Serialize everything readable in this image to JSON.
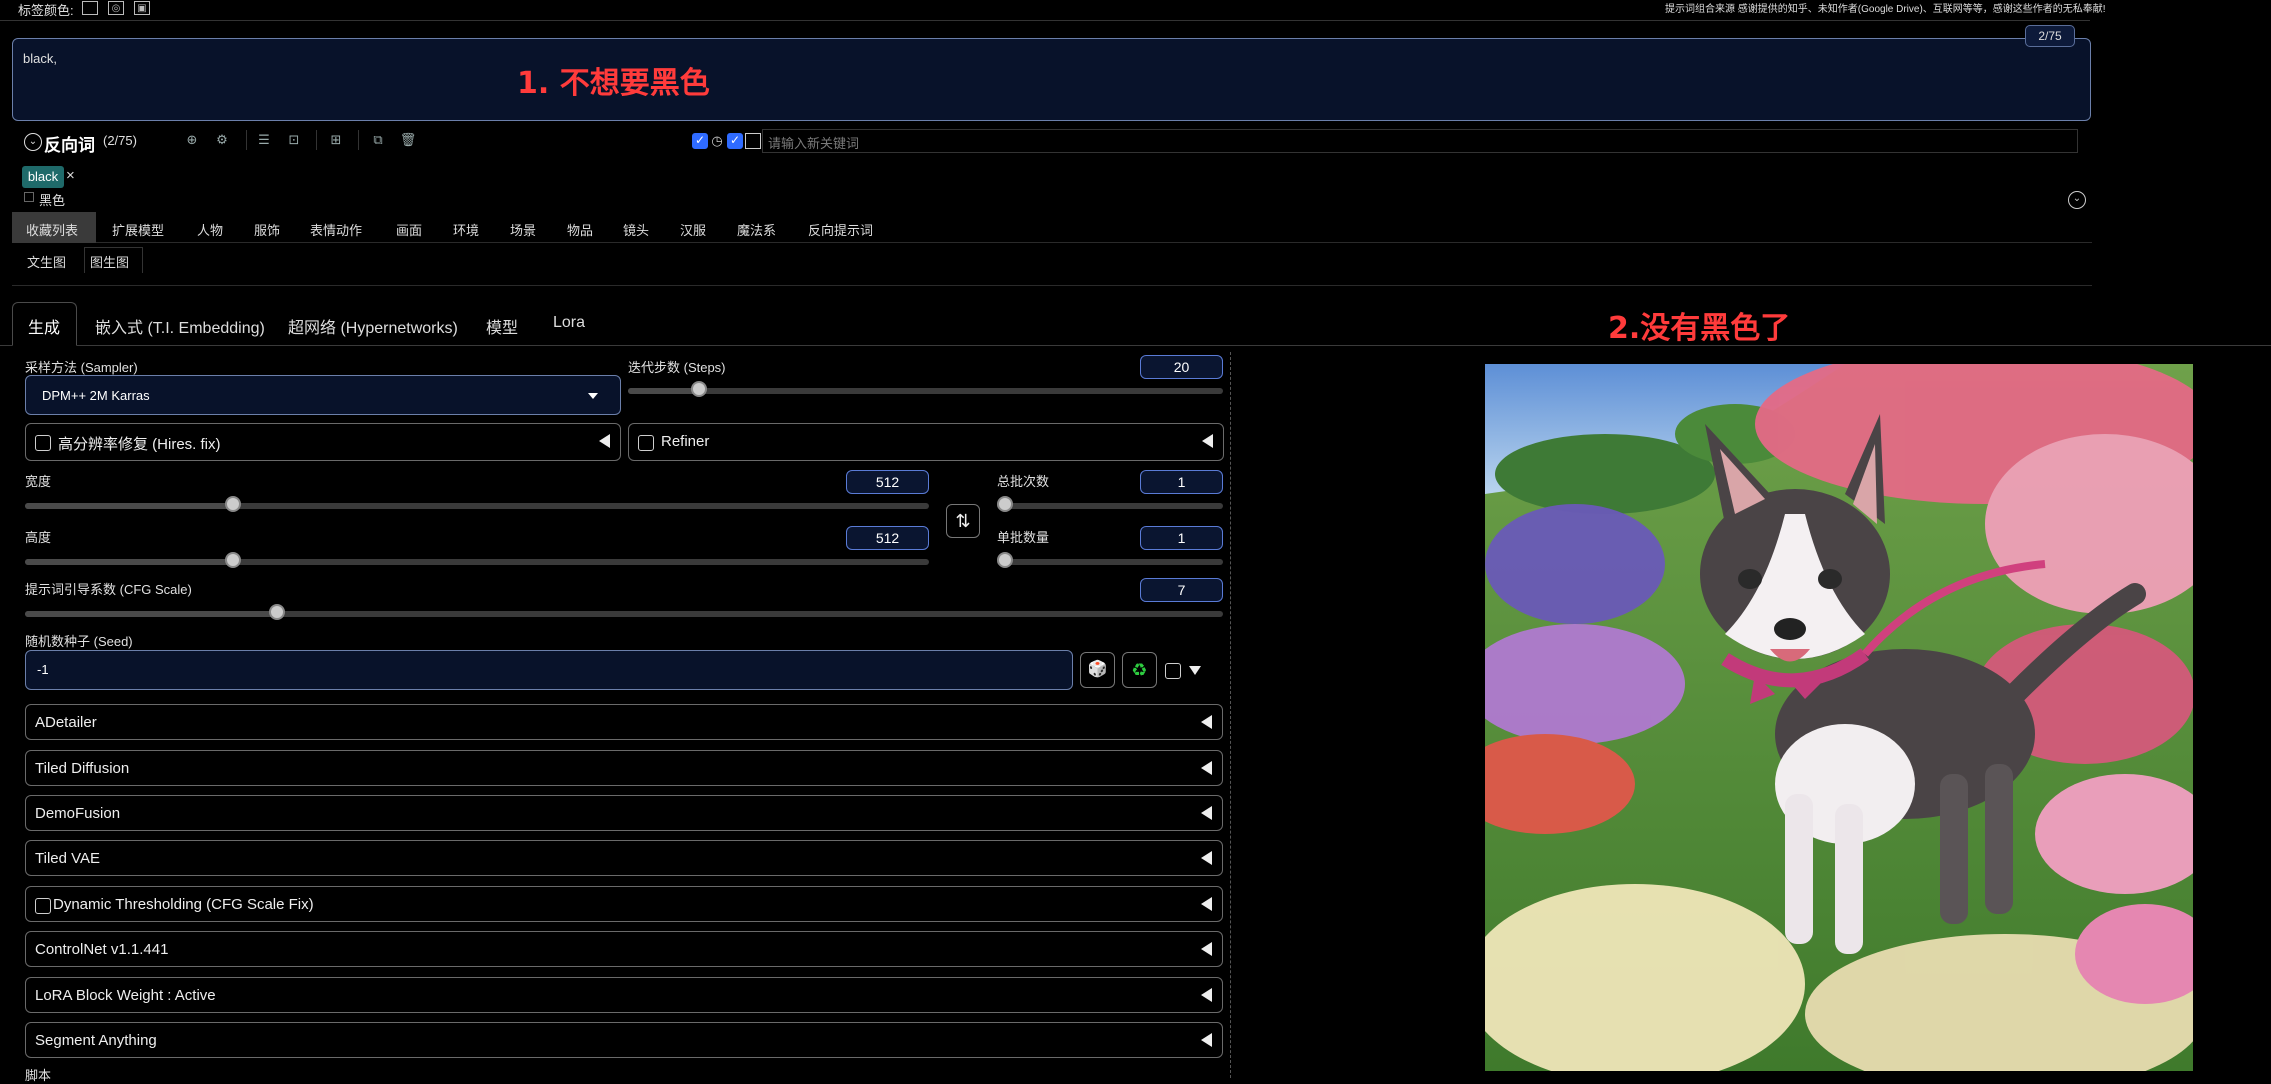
{
  "top": {
    "tag_color_label": "标签颜色:",
    "notice": "提示词组合来源 感谢提供的知乎、未知作者(Google Drive)、互联网等等，感谢这些作者的无私奉献!"
  },
  "prompt": {
    "value": "black,",
    "counter": "2/75"
  },
  "annotations": {
    "a1": "1. 不想要黑色",
    "a2": "2.没有黑色了"
  },
  "negative": {
    "title": "反向词",
    "count": "(2/75)",
    "keyword_placeholder": "请输入新关键词",
    "tag": "black",
    "tag_close": "×",
    "tag_translation": "黑色"
  },
  "categories": [
    "收藏列表",
    "扩展模型",
    "人物",
    "服饰",
    "表情动作",
    "画面",
    "环境",
    "场景",
    "物品",
    "镜头",
    "汉服",
    "魔法系",
    "反向提示词"
  ],
  "subtabs": [
    "文生图",
    "图生图"
  ],
  "main_tabs": [
    "生成",
    "嵌入式 (T.I. Embedding)",
    "超网络 (Hypernetworks)",
    "模型",
    "Lora"
  ],
  "sampler": {
    "label": "采样方法 (Sampler)",
    "value": "DPM++ 2M Karras"
  },
  "steps": {
    "label": "迭代步数 (Steps)",
    "value": "20",
    "fraction": 0.12
  },
  "hires": {
    "label": "高分辨率修复 (Hires. fix)"
  },
  "refiner": {
    "label": "Refiner"
  },
  "width": {
    "label": "宽度",
    "value": "512",
    "fraction": 0.23
  },
  "height": {
    "label": "高度",
    "value": "512",
    "fraction": 0.23
  },
  "batch_count": {
    "label": "总批次数",
    "value": "1",
    "fraction": 0.0
  },
  "batch_size": {
    "label": "单批数量",
    "value": "1",
    "fraction": 0.0
  },
  "cfg": {
    "label": "提示词引导系数 (CFG Scale)",
    "value": "7",
    "fraction": 0.21
  },
  "seed": {
    "label": "随机数种子 (Seed)",
    "value": "-1"
  },
  "accordions": [
    "ADetailer",
    "Tiled Diffusion",
    "DemoFusion",
    "Tiled VAE",
    "Dynamic Thresholding (CFG Scale Fix)",
    "ControlNet v1.1.441",
    "LoRA Block Weight : Active",
    "Segment Anything"
  ],
  "script_label": "脚本",
  "icons": {
    "swap": "⇅",
    "dice": "🎲",
    "recycle": "♻"
  }
}
